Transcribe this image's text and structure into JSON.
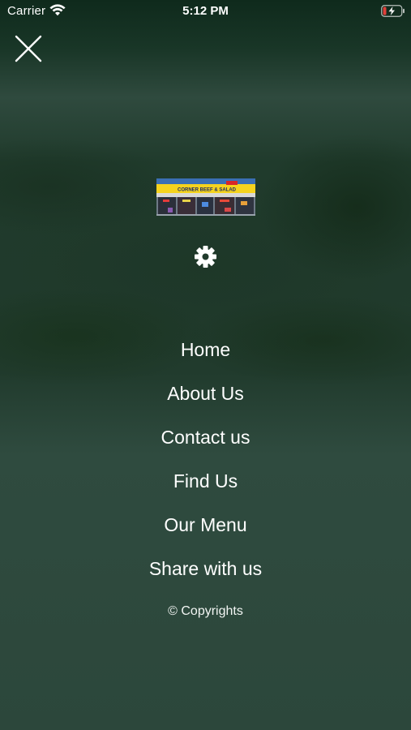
{
  "status_bar": {
    "carrier": "Carrier",
    "time": "5:12 PM",
    "wifi_icon": "wifi-icon",
    "battery_icon": "battery-charging-low-icon"
  },
  "close": {
    "icon": "close-icon"
  },
  "logo": {
    "sign_text": "CORNER BEEF & SALAD",
    "sign_color": "#f5d31e",
    "accent": "#d7262a"
  },
  "settings": {
    "icon": "gear-icon"
  },
  "menu": {
    "items": [
      {
        "label": "Home"
      },
      {
        "label": "About Us"
      },
      {
        "label": "Contact us"
      },
      {
        "label": "Find Us"
      },
      {
        "label": "Our Menu"
      },
      {
        "label": "Share with us"
      }
    ]
  },
  "footer": {
    "copyright": "© Copyrights"
  },
  "colors": {
    "background": "#2b4438",
    "text": "#ffffff",
    "battery_low": "#e0403a"
  }
}
